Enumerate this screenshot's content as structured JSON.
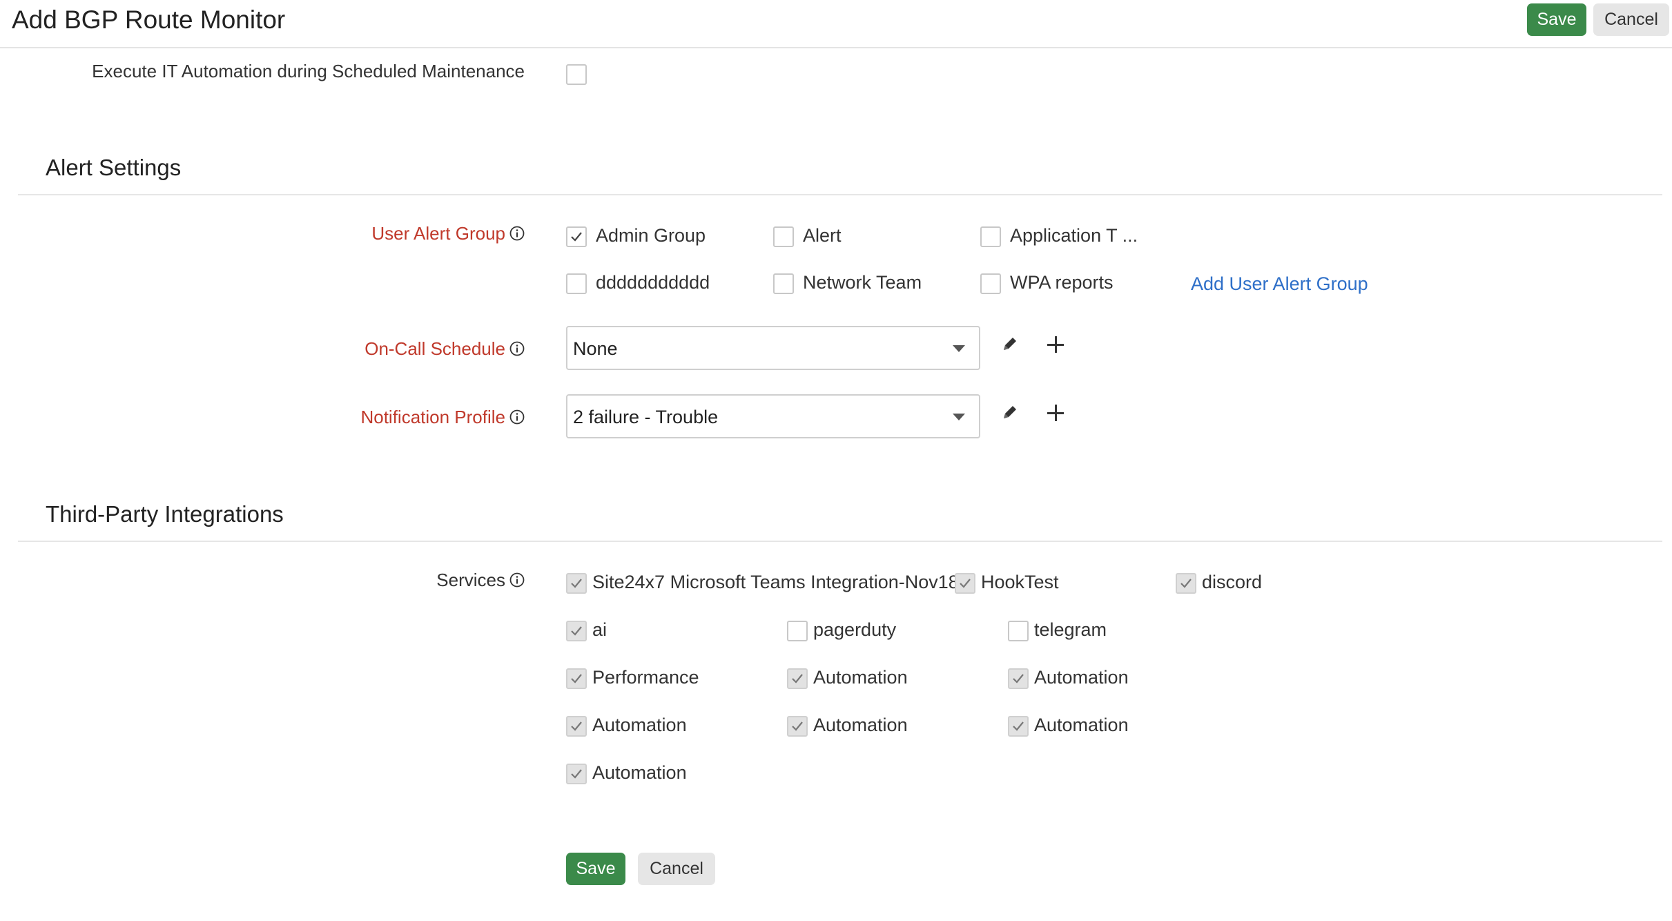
{
  "header": {
    "title": "Add BGP Route Monitor",
    "save_label": "Save",
    "cancel_label": "Cancel"
  },
  "maintenance": {
    "label": "Execute IT Automation during Scheduled Maintenance",
    "checked": false
  },
  "alert_settings": {
    "title": "Alert Settings",
    "user_alert_group": {
      "label": "User Alert Group",
      "options": [
        {
          "label": "Admin Group",
          "checked": true
        },
        {
          "label": "Alert",
          "checked": false
        },
        {
          "label": "Application T ...",
          "checked": false
        },
        {
          "label": "ddddddddddd",
          "checked": false
        },
        {
          "label": "Network Team",
          "checked": false
        },
        {
          "label": "WPA reports",
          "checked": false
        }
      ],
      "add_link": "Add User Alert Group"
    },
    "on_call_schedule": {
      "label": "On-Call Schedule",
      "value": "None"
    },
    "notification_profile": {
      "label": "Notification Profile",
      "value": "2 failure - Trouble"
    }
  },
  "integrations": {
    "title": "Third-Party Integrations",
    "services_label": "Services",
    "services": [
      {
        "label": "Site24x7 Microsoft Teams Integration-Nov18",
        "checked": true
      },
      {
        "label": "HookTest",
        "checked": true
      },
      {
        "label": "discord",
        "checked": true
      },
      {
        "label": "ai",
        "checked": true
      },
      {
        "label": "pagerduty",
        "checked": false
      },
      {
        "label": "telegram",
        "checked": false
      },
      {
        "label": "Performance",
        "checked": true
      },
      {
        "label": "Automation",
        "checked": true
      },
      {
        "label": "Automation",
        "checked": true
      },
      {
        "label": "Automation",
        "checked": true
      },
      {
        "label": "Automation",
        "checked": true
      },
      {
        "label": "Automation",
        "checked": true
      },
      {
        "label": "Automation",
        "checked": true
      }
    ]
  },
  "footer": {
    "save_label": "Save",
    "cancel_label": "Cancel"
  },
  "colors": {
    "save_green": "#3b8a4a",
    "required_red": "#c0392b",
    "link_blue": "#2e6fc8"
  }
}
